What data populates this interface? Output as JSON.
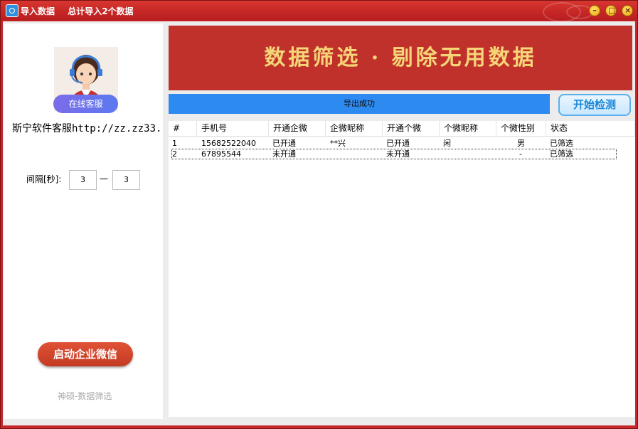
{
  "window": {
    "title": "导入数据",
    "subtitle": "总计导入2个数据",
    "controls": [
      "minimize",
      "maximize",
      "close"
    ]
  },
  "left_panel": {
    "online_service_label": "在线客服",
    "service_text": "斯宁软件客服http://zz.zz33.",
    "interval_label": "间隔[秒]:",
    "interval_min": "3",
    "interval_max": "3",
    "interval_separator": "一",
    "start_button": "启动企业微信",
    "footer": "神硕-数据筛选"
  },
  "banner": {
    "text": "数据筛选 · 剔除无用数据"
  },
  "status": {
    "progress_text": "导出成功",
    "progress_percent": 100,
    "detect_button": "开始检测"
  },
  "table": {
    "columns": [
      "#",
      "手机号",
      "开通企微",
      "企微昵称",
      "开通个微",
      "个微昵称",
      "个微性别",
      "状态"
    ],
    "rows": [
      [
        "1",
        "15682522040",
        "已开通",
        "**兴",
        "已开通",
        "闲",
        "男",
        "已筛选"
      ],
      [
        "2",
        "67895544",
        "未开通",
        "",
        "未开通",
        "",
        "-",
        "已筛选"
      ]
    ],
    "selected_row": 2
  },
  "colors": {
    "frame": "#c8262b",
    "banner_bg": "#c0312b",
    "banner_text": "#f5d577",
    "progress": "#2d8af0",
    "start_button": "#d04a2c"
  }
}
